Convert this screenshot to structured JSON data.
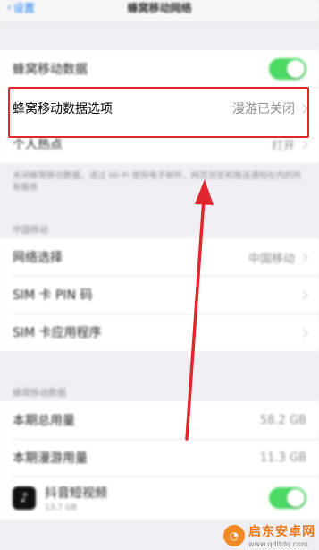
{
  "nav": {
    "back_label": "设置",
    "title": "蜂窝移动网络"
  },
  "cellular_data": {
    "label": "蜂窝移动数据",
    "toggle_on": true
  },
  "options": {
    "label": "蜂窝移动数据选项",
    "value": "漫游已关闭"
  },
  "hotspot": {
    "label": "个人热点",
    "value": "打开"
  },
  "footer_note": "关闭蜂窝移动数据，请过 Wi-Fi 使用电子邮件、网页浏览和推送通知在内的所有服务",
  "carrier": {
    "header": "中国移动",
    "rows": [
      {
        "label": "网络选择",
        "value": "中国移动"
      },
      {
        "label": "SIM 卡 PIN 码",
        "value": ""
      },
      {
        "label": "SIM 卡应用程序",
        "value": ""
      }
    ]
  },
  "usage": {
    "header": "蜂窝移动数据",
    "rows": [
      {
        "label": "本期总用量",
        "value": "58.2 GB"
      },
      {
        "label": "本期漫游用量",
        "value": "11.3 GB"
      }
    ],
    "app": {
      "name": "抖音短视频",
      "size": "13.7 GB",
      "toggle_on": true
    }
  },
  "watermark": {
    "name": "启东安卓网",
    "url": "www.qdltdq.com"
  },
  "colors": {
    "accent": "#e0272d",
    "toggle": "#4cd964",
    "link": "#1a7cf2"
  }
}
